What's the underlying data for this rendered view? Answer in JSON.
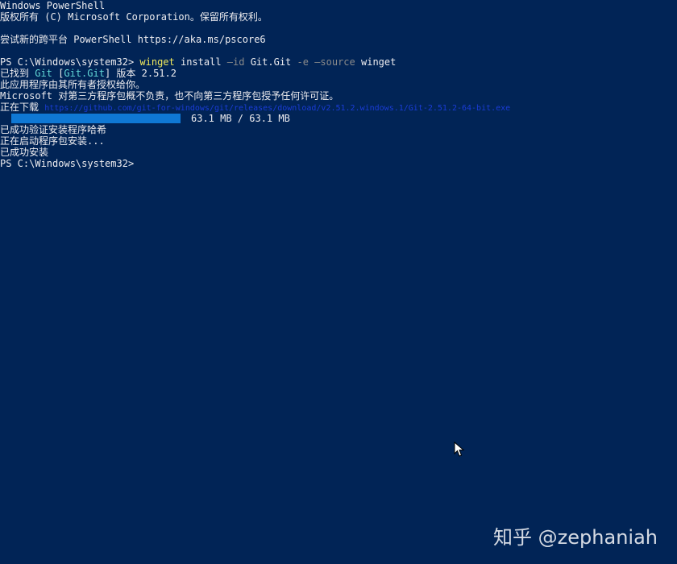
{
  "terminal": {
    "header_line1": "Windows PowerShell",
    "header_line2": "版权所有 (C) Microsoft Corporation。保留所有权利。",
    "header_line3": "尝试新的跨平台 PowerShell https://aka.ms/pscore6",
    "prompt1": "PS C:\\Windows\\system32> ",
    "cmd_name": "winget",
    "cmd_sub": " install ",
    "cmd_param_id": "—id",
    "cmd_arg_id": " Git.Git ",
    "cmd_param_e": "-e",
    "cmd_space": " ",
    "cmd_param_source": "—source",
    "cmd_arg_source": " winget",
    "found_prefix": "已找到 ",
    "found_name": "Git",
    "found_bracket_open": " [",
    "found_id": "Git.Git",
    "found_bracket_close": "]",
    "found_suffix": " 版本 2.51.2",
    "license_line": "此应用程序由其所有者授权给你。",
    "ms_line": "Microsoft 对第三方程序包概不负责，也不向第三方程序包授予任何许可证。",
    "downloading_prefix": "正在下载 ",
    "download_url": "https://github.com/git-for-windows/git/releases/download/v2.51.2.windows.1/Git-2.51.2-64-bit.exe",
    "progress_text": "63.1 MB / 63.1 MB",
    "progress_fraction": 1.0,
    "verified_line": "已成功验证安装程序哈希",
    "starting_line": "正在启动程序包安装...",
    "installed_line": "已成功安装",
    "prompt2": "PS C:\\Windows\\system32>"
  },
  "watermark": {
    "text": "知乎 @zephaniah"
  },
  "colors": {
    "background": "#012456",
    "progress_fill": "#0f78d4",
    "command": "#f0e85c",
    "highlight": "#61d6d6",
    "param": "#8a8a8a"
  },
  "icons": {
    "cursor": "mouse-pointer-icon"
  }
}
